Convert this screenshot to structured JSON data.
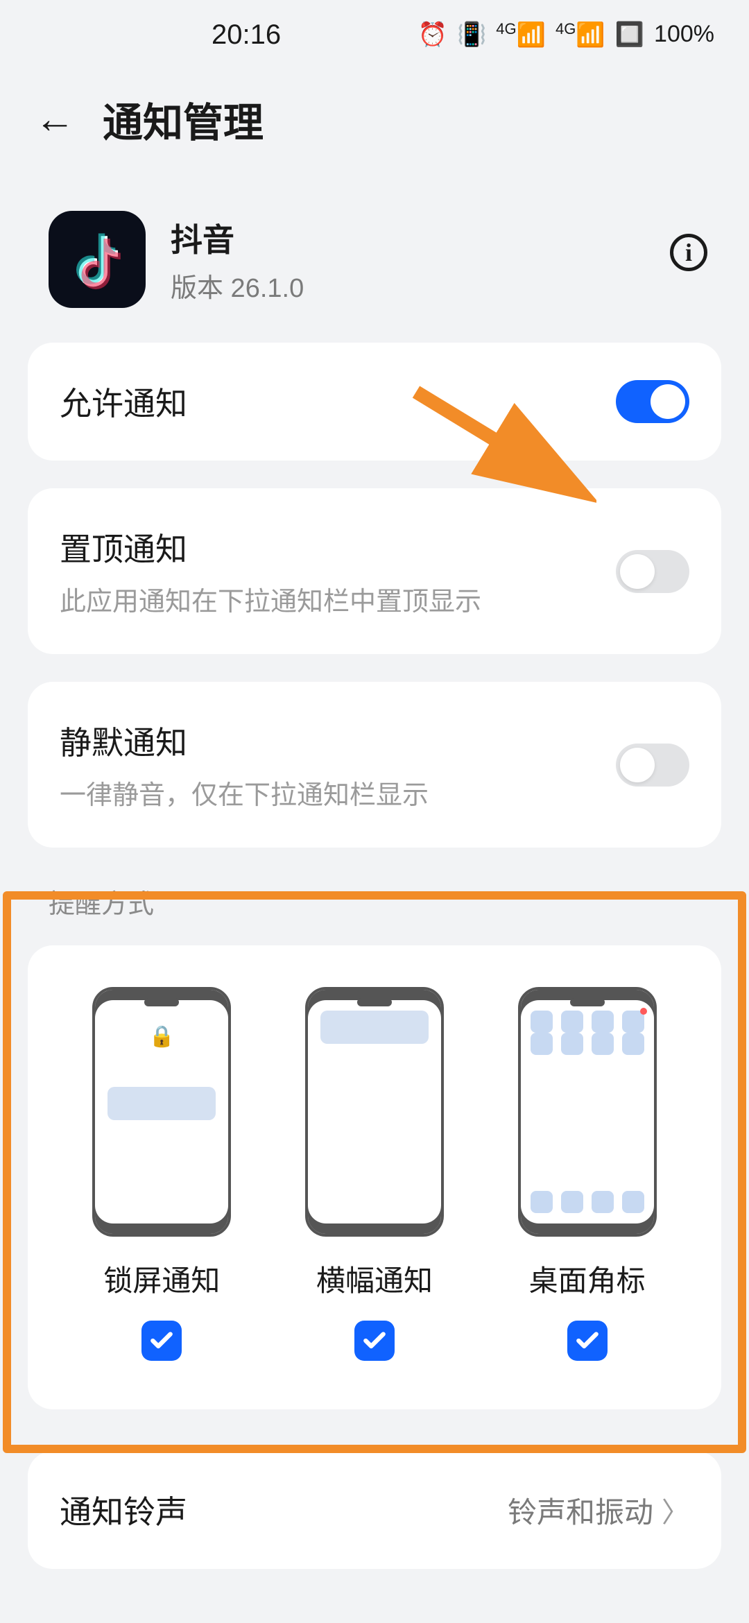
{
  "status": {
    "time": "20:16",
    "battery": "100%",
    "network": "4G"
  },
  "header": {
    "title": "通知管理"
  },
  "app": {
    "name": "抖音",
    "version_label": "版本 26.1.0"
  },
  "rows": {
    "allow": {
      "title": "允许通知",
      "on": true
    },
    "pin": {
      "title": "置顶通知",
      "subtitle": "此应用通知在下拉通知栏中置顶显示",
      "on": false
    },
    "silent": {
      "title": "静默通知",
      "subtitle": "一律静音，仅在下拉通知栏显示",
      "on": false
    },
    "ringtone": {
      "title": "通知铃声",
      "value": "铃声和振动"
    }
  },
  "modes": {
    "section_title": "提醒方式",
    "lock": {
      "label": "锁屏通知",
      "checked": true
    },
    "banner": {
      "label": "横幅通知",
      "checked": true
    },
    "badge": {
      "label": "桌面角标",
      "checked": true
    }
  }
}
